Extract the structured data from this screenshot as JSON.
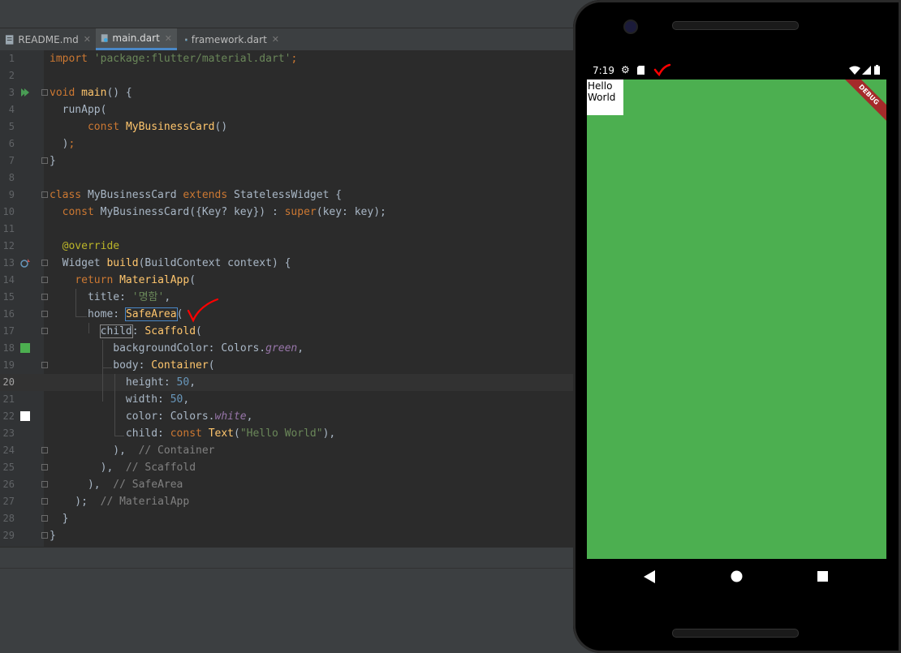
{
  "tabs": [
    {
      "label": "README.md",
      "active": false
    },
    {
      "label": "main.dart",
      "active": true
    },
    {
      "label": "framework.dart",
      "active": false
    }
  ],
  "code_lines": [
    {
      "n": "1"
    },
    {
      "n": "2"
    },
    {
      "n": "3"
    },
    {
      "n": "4"
    },
    {
      "n": "5"
    },
    {
      "n": "6"
    },
    {
      "n": "7"
    },
    {
      "n": "8"
    },
    {
      "n": "9"
    },
    {
      "n": "10"
    },
    {
      "n": "11"
    },
    {
      "n": "12"
    },
    {
      "n": "13"
    },
    {
      "n": "14"
    },
    {
      "n": "15"
    },
    {
      "n": "16"
    },
    {
      "n": "17"
    },
    {
      "n": "18"
    },
    {
      "n": "19"
    },
    {
      "n": "20"
    },
    {
      "n": "21"
    },
    {
      "n": "22"
    },
    {
      "n": "23"
    },
    {
      "n": "24"
    },
    {
      "n": "25"
    },
    {
      "n": "26"
    },
    {
      "n": "27"
    },
    {
      "n": "28"
    },
    {
      "n": "29"
    }
  ],
  "code": {
    "l1_import": "import",
    "l1_path": "'package:flutter/material.dart'",
    "l3_void": "void",
    "l3_main": "main",
    "l4_runapp": "runApp(",
    "l5_const": "const",
    "l5_cls": "MyBusinessCard",
    "l9_class": "class",
    "l9_name": "MyBusinessCard",
    "l9_extends": "extends",
    "l9_super": "StatelessWidget {",
    "l10_const": "const",
    "l10_rest": "MyBusinessCard({Key? key}) : ",
    "l10_super": "super",
    "l10_tail": "(key: key);",
    "l12_override": "@override",
    "l13_widget": "Widget ",
    "l13_build": "build",
    "l13_rest": "(BuildContext context) {",
    "l14_return": "return",
    "l14_app": "MaterialApp",
    "l15_title": "title: ",
    "l15_val": "'명함'",
    "l16_home": "home: ",
    "l16_safe": "SafeArea",
    "l17_child": "child",
    "l17_scaffold": "Scaffold",
    "l18_bg": "backgroundColor: Colors.",
    "l18_green": "green",
    "l19_body": "body: ",
    "l19_container": "Container",
    "l20_height": "height: ",
    "l20_val": "50",
    "l21_width": "width: ",
    "l21_val": "50",
    "l22_color": "color: Colors.",
    "l22_white": "white",
    "l23_child": "child: ",
    "l23_const": "const",
    "l23_text": "Text",
    "l23_str": "\"Hello World\"",
    "l24_cm": "// Container",
    "l25_cm": "// Scaffold",
    "l26_cm": "// SafeArea",
    "l27_cm": "// MaterialApp"
  },
  "phone": {
    "time": "7:19",
    "hello_text": "Hello World",
    "debug_label": "DEBUG",
    "screen_color": "#4caf50"
  },
  "colors": {
    "editor_bg": "#2b2b2b",
    "keyword": "#cc7832",
    "string": "#6a8759",
    "number": "#6897bb",
    "annotation_mark": "#ff0000"
  }
}
